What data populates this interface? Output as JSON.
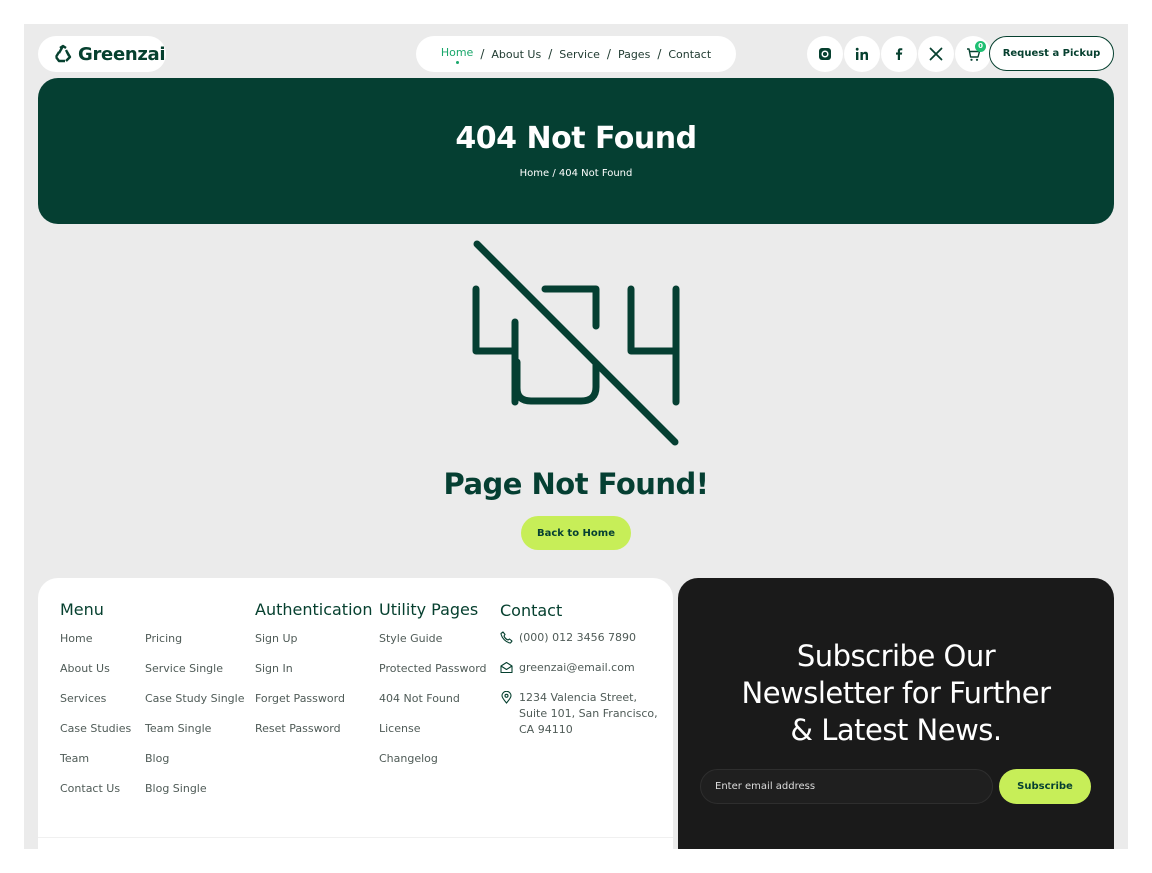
{
  "brand": {
    "name": "Greenzai",
    "accent": "#c7ee58",
    "primary": "#053f32"
  },
  "nav": {
    "items": [
      "Home",
      "About Us",
      "Service",
      "Pages",
      "Contact"
    ],
    "separator": "/",
    "active": "Home"
  },
  "social": {
    "icons": [
      "instagram-icon",
      "linkedin-icon",
      "facebook-icon",
      "x-icon"
    ]
  },
  "cart": {
    "count": "0"
  },
  "header": {
    "cta": "Request a Pickup"
  },
  "hero": {
    "title": "404 Not Found",
    "breadcrumb": "Home / 404 Not Found"
  },
  "error": {
    "heading": "Page Not Found!",
    "button": "Back to Home"
  },
  "footer": {
    "menu": {
      "title": "Menu",
      "col1": [
        "Home",
        "About Us",
        "Services",
        "Case Studies",
        "Team",
        "Contact Us"
      ],
      "col2": [
        "Pricing",
        "Service Single",
        "Case Study Single",
        "Team Single",
        "Blog",
        "Blog Single"
      ]
    },
    "auth": {
      "title": "Authentication",
      "items": [
        "Sign Up",
        "Sign In",
        "Forget Password",
        "Reset Password"
      ]
    },
    "utility": {
      "title": "Utility Pages",
      "items": [
        "Style Guide",
        "Protected Password",
        "404 Not Found",
        "License",
        "Changelog"
      ]
    },
    "contact": {
      "title": "Contact",
      "phone": "(000) 012 3456 7890",
      "email": "greenzai@email.com",
      "address": [
        "1234 Valencia Street,",
        "Suite 101, San Francisco,",
        "CA 94110"
      ]
    }
  },
  "newsletter": {
    "title_lines": [
      "Subscribe Our",
      "Newsletter for Further",
      "& Latest News."
    ],
    "placeholder": "Enter email address",
    "button": "Subscribe"
  }
}
